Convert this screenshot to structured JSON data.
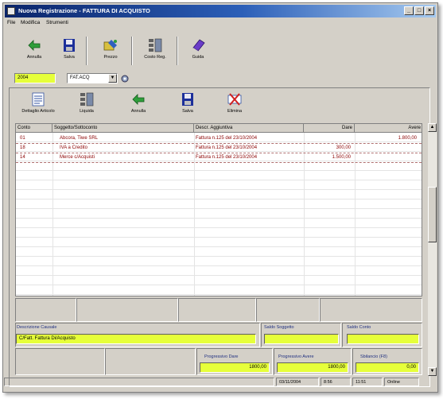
{
  "window": {
    "title": "Nuova Registrazione - FATTURA DI ACQUISTO"
  },
  "menu": {
    "file": "File",
    "modifica": "Modifica",
    "strumenti": "Strumenti"
  },
  "toolbar1": [
    {
      "label": "Annulla",
      "icon": "undo-arrow-icon"
    },
    {
      "label": "Salva",
      "icon": "floppy-disk-icon"
    },
    {
      "label": "Prezzo",
      "icon": "price-icon"
    },
    {
      "label": "Costo Reg.",
      "icon": "calculator-icon"
    },
    {
      "label": "Guida",
      "icon": "help-book-icon"
    }
  ],
  "selector": {
    "code": "2004",
    "period": "FAT.ACQ"
  },
  "toolbar2": [
    {
      "label": "Dettaglio Articolo",
      "icon": "detail-sheet-icon"
    },
    {
      "label": "Liquida",
      "icon": "calculator-icon"
    },
    {
      "label": "Annulla",
      "icon": "undo-arrow-icon"
    },
    {
      "label": "Salva",
      "icon": "floppy-disk-icon"
    },
    {
      "label": "Elimina",
      "icon": "delete-cross-icon"
    }
  ],
  "grid": {
    "columns": [
      "Conto",
      "Soggetto/Sottoconto",
      "Descr. Aggiuntiva",
      "Dare",
      "Avere"
    ],
    "rows": [
      {
        "conto": "01",
        "soggetto": "Abcora, Tiwe SRL",
        "descr": "Fattura n.125 del 23/10/2004",
        "dare": "",
        "avere": "1.800,00"
      },
      {
        "conto": "18",
        "soggetto": "IVA a Credito",
        "descr": "Fattura n.125 del 23/10/2004",
        "dare": "300,00",
        "avere": ""
      },
      {
        "conto": "14",
        "soggetto": "Merce c/Acquisti",
        "descr": "Fattura n.125 del 23/10/2004",
        "dare": "1.500,00",
        "avere": ""
      }
    ]
  },
  "details": {
    "descr_label": "Descrizione Causale",
    "descr_value": "C/Fatt. Fattura Di/Acquisto",
    "saldo_soggetto_label": "Saldo Soggetto",
    "saldo_conto_label": "Saldo Conto",
    "prog_dare_label": "Progressivo Dare",
    "prog_dare_value": "1800,00",
    "prog_avere_label": "Progressivo Avere",
    "prog_avere_value": "1800,00",
    "sbilancio_label": "Sbilancio (F8)",
    "sbilancio_value": "0,00"
  },
  "status": {
    "date": "03/11/2004",
    "time": "8:56",
    "p3": "11:51",
    "p4": "Online"
  }
}
